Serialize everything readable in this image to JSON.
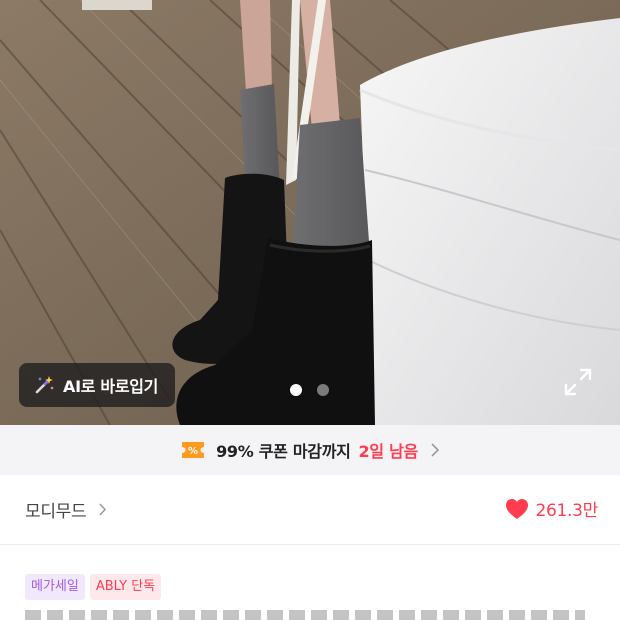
{
  "hero": {
    "ai_button_label": "AI로 바로입기",
    "carousel": {
      "total": 2,
      "active_index": 0
    },
    "icons": {
      "ai": "magic-wand-icon",
      "expand": "expand-icon"
    }
  },
  "coupon": {
    "text": "99% 쿠폰 마감까지",
    "days_left": "2일 남음",
    "accent_color": "#ff3c50",
    "badge_color": "#ff9a1f",
    "icons": {
      "badge": "coupon-icon",
      "chevron": "chevron-right-icon"
    }
  },
  "store": {
    "name": "모디무드",
    "like_count": "261.3만",
    "icons": {
      "heart": "heart-icon",
      "chevron": "chevron-right-icon"
    }
  },
  "tags": [
    {
      "label": "메가세일",
      "color": "#a05ce0"
    },
    {
      "label": "ABLY 단독",
      "color": "#ff3c50"
    }
  ]
}
